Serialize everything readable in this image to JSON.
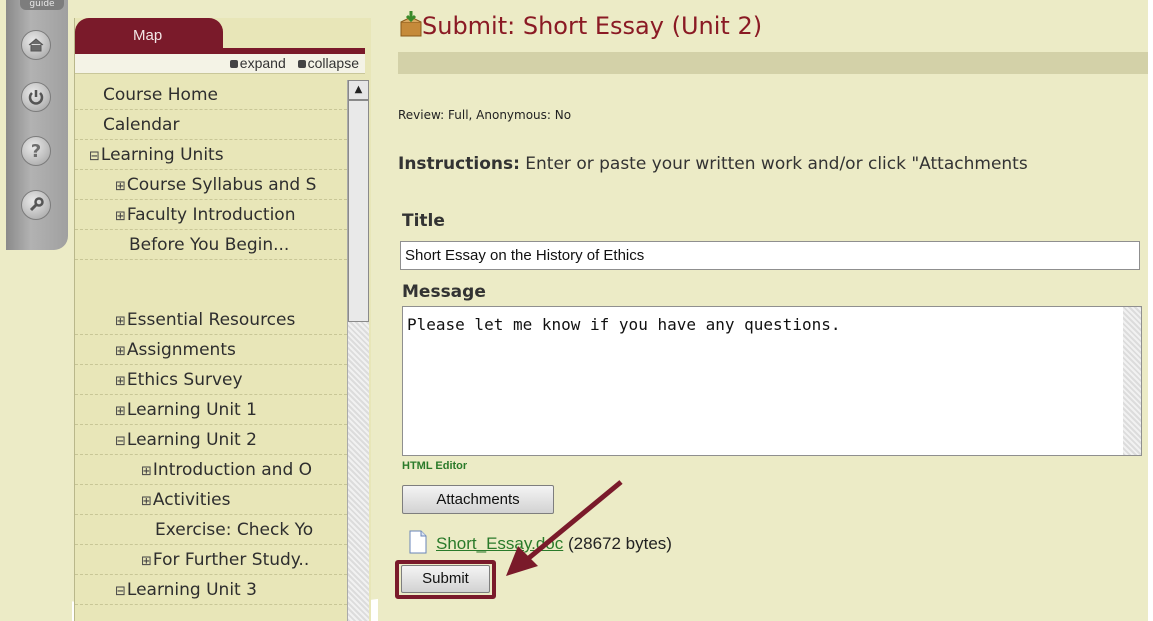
{
  "rail": {
    "guide_label": "guide",
    "icons": [
      "home-icon",
      "power-icon",
      "help-icon",
      "tools-icon"
    ]
  },
  "map": {
    "tab_label": "Map",
    "expand_label": "expand",
    "collapse_label": "collapse",
    "items": [
      {
        "label": "Course Home",
        "toggle": "",
        "indent": 0
      },
      {
        "label": "Calendar",
        "toggle": "",
        "indent": 0
      },
      {
        "label": "Learning Units",
        "toggle": "⊟",
        "indent": 0
      },
      {
        "label": "Course Syllabus and S",
        "toggle": "⊞",
        "indent": 1
      },
      {
        "label": "Faculty Introduction",
        "toggle": "⊞",
        "indent": 1
      },
      {
        "label": "Before You Begin...",
        "toggle": "",
        "indent": 1
      },
      {
        "label": "",
        "toggle": "",
        "indent": 1
      },
      {
        "label": "Essential Resources",
        "toggle": "⊞",
        "indent": 1
      },
      {
        "label": "Assignments",
        "toggle": "⊞",
        "indent": 1
      },
      {
        "label": "Ethics Survey",
        "toggle": "⊞",
        "indent": 1
      },
      {
        "label": "Learning Unit 1",
        "toggle": "⊞",
        "indent": 1
      },
      {
        "label": "Learning Unit 2",
        "toggle": "⊟",
        "indent": 1
      },
      {
        "label": "Introduction and O",
        "toggle": "⊞",
        "indent": 2
      },
      {
        "label": "Activities",
        "toggle": "⊞",
        "indent": 2
      },
      {
        "label": "Exercise: Check Yo",
        "toggle": "",
        "indent": 2
      },
      {
        "label": "For Further Study..",
        "toggle": "⊞",
        "indent": 2
      },
      {
        "label": "Learning Unit 3",
        "toggle": "⊟",
        "indent": 1
      }
    ]
  },
  "page": {
    "title": "Submit: Short Essay (Unit 2)",
    "review": "Review: Full, Anonymous: No",
    "instructions_label": "Instructions:",
    "instructions_text": " Enter or paste your written work and/or click \"Attachments",
    "title_label": "Title",
    "title_value": "Short Essay on the History of Ethics",
    "message_label": "Message",
    "message_value": "Please let me know if you have any questions.",
    "html_editor_link": "HTML Editor",
    "attachments_button": "Attachments",
    "attachment_file": "Short_Essay.doc",
    "attachment_size": "(28672 bytes)",
    "submit_button": "Submit"
  },
  "colors": {
    "background": "#ecebc6",
    "map_tab": "#7a1a2a",
    "title_text": "#8a1a24",
    "link_green": "#2a7a2a",
    "annotation_arrow": "#7a1a2a"
  }
}
